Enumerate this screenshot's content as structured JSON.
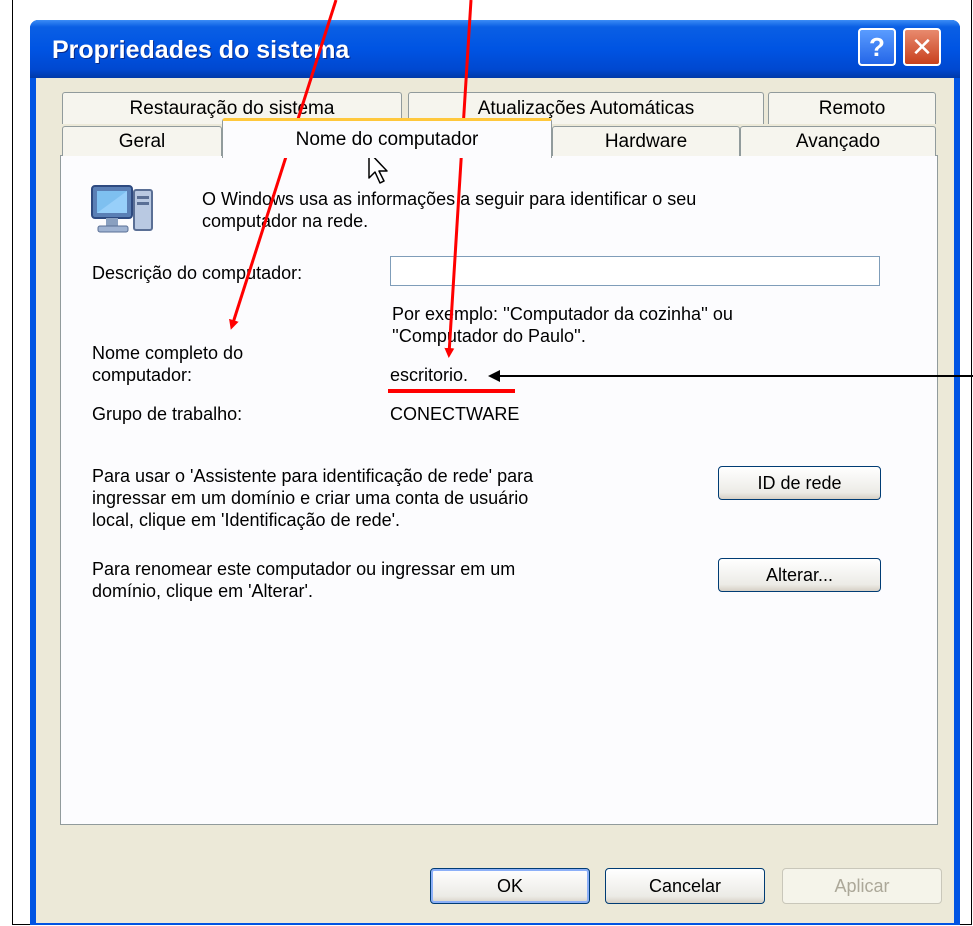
{
  "window": {
    "title": "Propriedades do sistema",
    "help_button": "?",
    "close_button": "✕"
  },
  "tabs_row1": [
    "Restauração do sistema",
    "Atualizações Automáticas",
    "Remoto"
  ],
  "tabs_row2": [
    "Geral",
    "Nome do computador",
    "Hardware",
    "Avançado"
  ],
  "active_tab": "Nome do computador",
  "panel": {
    "intro_line1": "O Windows usa as informações a seguir para identificar o seu",
    "intro_line2": "computador na rede.",
    "description_label": "Descrição do computador:",
    "description_value": "",
    "example_line1": "Por exemplo: ''Computador da cozinha'' ou",
    "example_line2": "''Computador do Paulo''.",
    "fullname_label_line1": "Nome completo do",
    "fullname_label_line2": "computador:",
    "fullname_value": "escritorio.",
    "workgroup_label": "Grupo de trabalho:",
    "workgroup_value": "CONECTWARE",
    "network_id_text_line1": "Para usar o 'Assistente para identificação de rede' para",
    "network_id_text_line2": "ingressar em um domínio e criar uma conta de usuário",
    "network_id_text_line3": "local, clique em 'Identificação de rede'.",
    "network_id_button": "ID de rede",
    "rename_text_line1": "Para renomear este computador ou ingressar em um",
    "rename_text_line2": "domínio, clique em 'Alterar'.",
    "change_button": "Alterar..."
  },
  "footer": {
    "ok_button": "OK",
    "cancel_button": "Cancelar",
    "apply_button": "Aplicar"
  },
  "colors": {
    "title_bar": "#0054e3",
    "dialog_bg": "#ece9d8",
    "annotation_red": "#ff0000",
    "annotation_black": "#000000"
  },
  "icons": [
    "help-icon",
    "close-icon",
    "computer-network-icon",
    "mouse-pointer-icon"
  ]
}
